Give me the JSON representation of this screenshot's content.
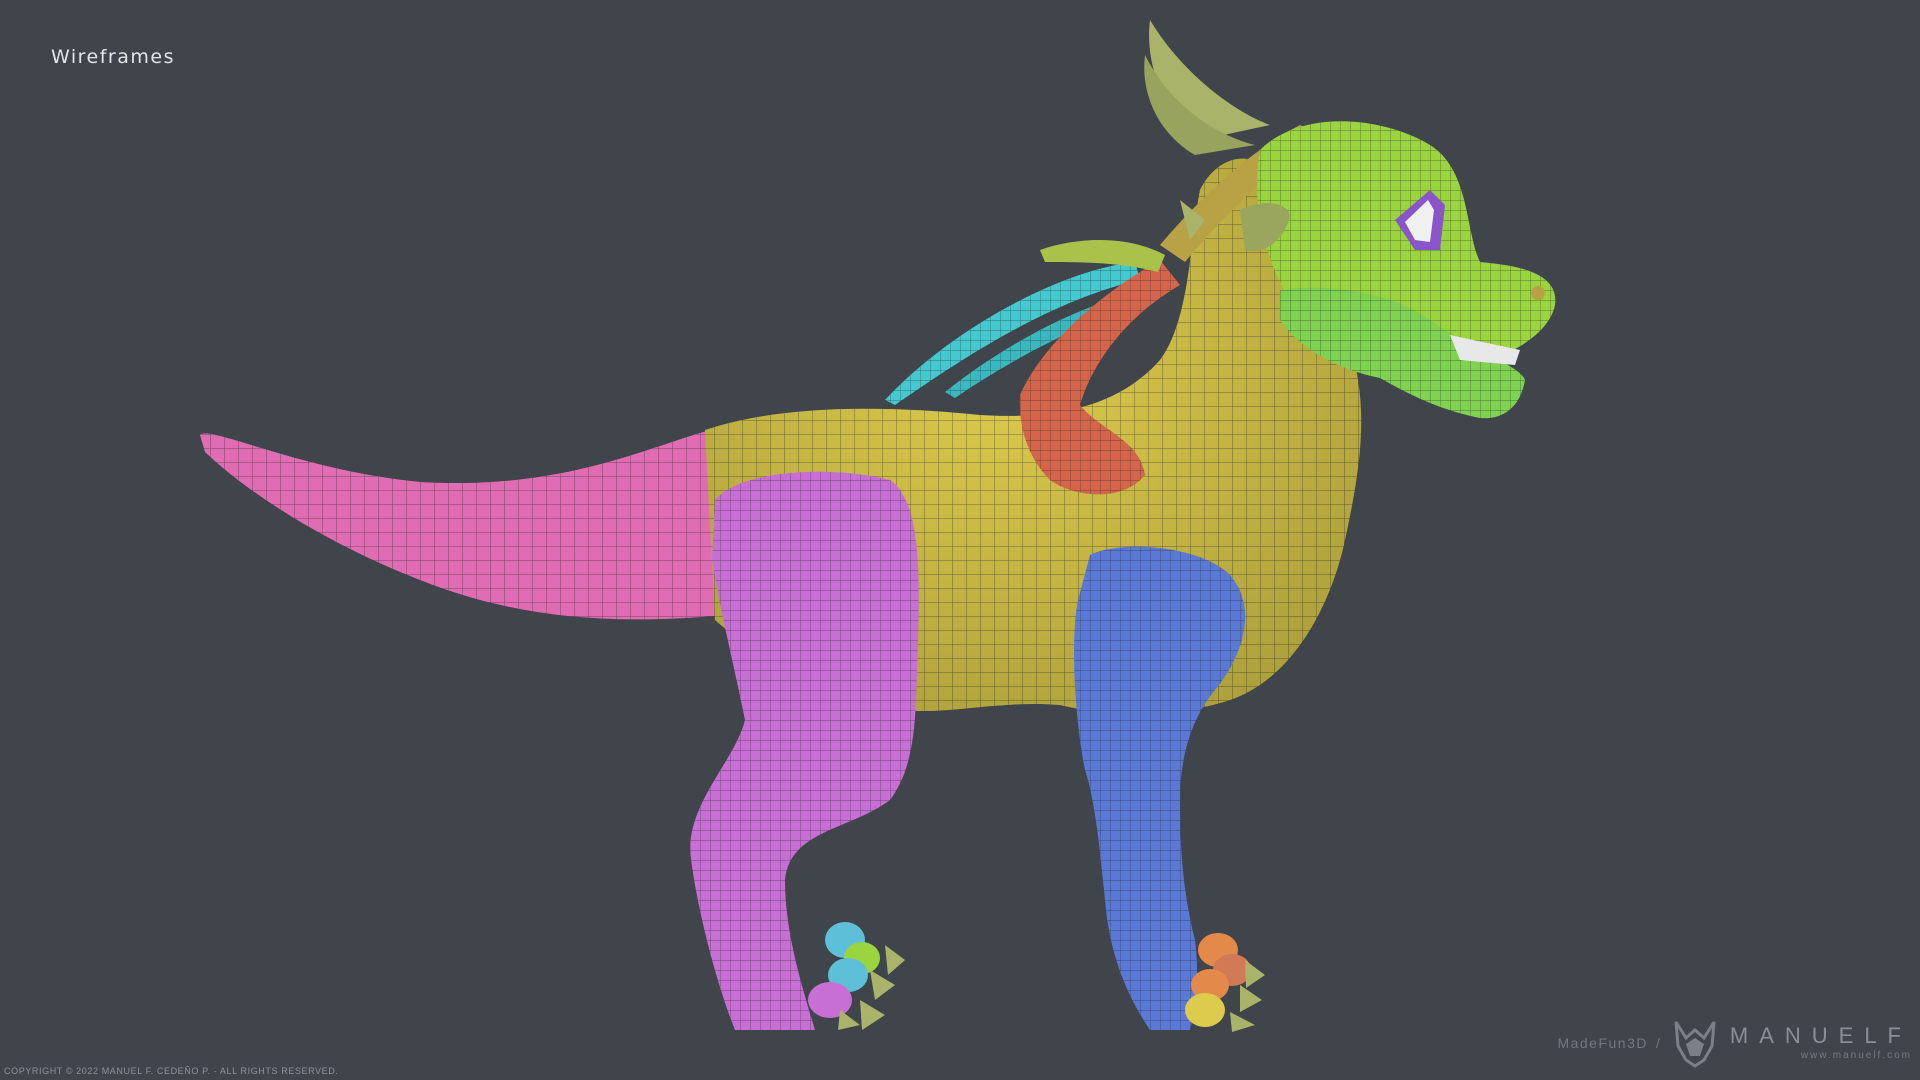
{
  "title": "Wireframes",
  "copyright": "COPYRIGHT © 2022 MANUEL F. CEDEÑO P. - ALL RIGHTS RESERVED.",
  "brand": {
    "studio": "MadeFun3D",
    "separator": "/",
    "name": "MANUELF",
    "url": "www.manuelf.com"
  },
  "colors": {
    "background": "#40444b",
    "tail": "#e06db3",
    "body": "#dccb4c",
    "hind_leg": "#c76fd4",
    "front_leg": "#5a78d6",
    "head": "#9ad43e",
    "jaw": "#7fd351",
    "horns": "#a9b46a",
    "wing_arm": "#d5654a",
    "wing_membrane": "#44c9d0",
    "wireframe_lines": "#2a2a2a"
  }
}
